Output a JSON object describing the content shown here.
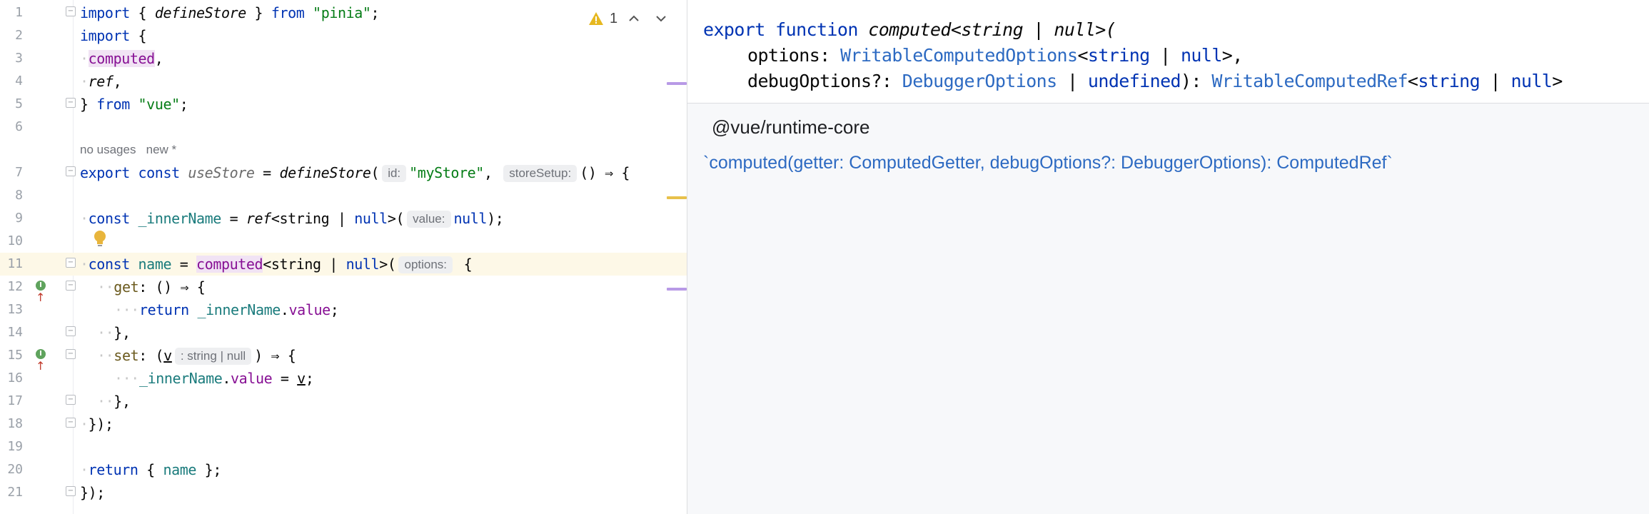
{
  "editor": {
    "line_numbers": [
      "1",
      "2",
      "3",
      "4",
      "5",
      "6",
      "7",
      "8",
      "9",
      "10",
      "11",
      "12",
      "13",
      "14",
      "15",
      "16",
      "17",
      "18",
      "19",
      "20",
      "21"
    ],
    "line1": {
      "kw_import": "import",
      "open": "{ ",
      "fn": "defineStore",
      "close": " } ",
      "kw_from": "from",
      "str": "\"pinia\"",
      "semi": ";"
    },
    "line2": {
      "kw_import": "import",
      "brace": " {"
    },
    "line3": {
      "name": "computed",
      "comma": ","
    },
    "line4": {
      "name": "ref",
      "comma": ","
    },
    "line5": {
      "brace": "} ",
      "kw_from": "from",
      "str": "\"vue\"",
      "semi": ";"
    },
    "usage_hint": "no usages   new *",
    "line7": {
      "kw_export": "export",
      "kw_const": "const",
      "var": "useStore",
      "eq": " = ",
      "fn": "defineStore",
      "paren": "(",
      "hint_id": "id:",
      "str": "\"myStore\"",
      "comma": ",",
      "hint_setup": "storeSetup:",
      "arrow": "() ⇒ {"
    },
    "line9": {
      "kw_const": "const",
      "var": "_innerName",
      "eq": " = ",
      "fn": "ref",
      "generic": "<string | ",
      "kw_null": "null",
      "gen_close": ">(",
      "hint_value": "value:",
      "kw_null2": "null",
      "end": ");"
    },
    "line11": {
      "kw_const": "const",
      "var": "name",
      "eq": " = ",
      "fn": "computed",
      "generic": "<string | ",
      "kw_null": "null",
      "gen_close": ">(",
      "hint_options": "options:",
      "brace": " {"
    },
    "line12": {
      "key": "get",
      "rest": ": () ⇒ {"
    },
    "line13": {
      "kw_return": "return",
      "var": "_innerName",
      "dot": ".",
      "prop": "value",
      "semi": ";"
    },
    "line14": {
      "text": "},"
    },
    "line15": {
      "key": "set",
      "rest1": ": (",
      "param": "v",
      "hint_type": ": string | null",
      "rest2": ") ⇒ {"
    },
    "line16": {
      "var": "_innerName",
      "dot": ".",
      "prop": "value",
      "eq": " = ",
      "param": "v",
      "semi": ";"
    },
    "line17": {
      "text": "},"
    },
    "line18": {
      "text": "});"
    },
    "line20": {
      "kw_return": "return",
      "rest": " { ",
      "var": "name",
      "close": " };"
    },
    "line21": {
      "text": "});"
    },
    "warnings": {
      "count": "1",
      "icon": "warning-icon"
    },
    "colors": {
      "keyword": "#0033b3",
      "string": "#067d17",
      "current_line": "#fdf8e7",
      "scroll_purple": "#b89ae6",
      "scroll_yellow": "#e8c14a"
    }
  },
  "doc": {
    "sig_line1": {
      "kw_export": "export",
      "kw_function": "function",
      "fn": "computed",
      "generic": "<string | null>("
    },
    "sig_line2": {
      "label": "options: ",
      "type": "WritableComputedOptions",
      "generic_open": "<",
      "kw_string": "string",
      "pipe": " | ",
      "kw_null": "null",
      "generic_close": ">,"
    },
    "sig_line3": {
      "label": "debugOptions?: ",
      "type": "DebuggerOptions",
      "pipe": " | ",
      "kw_undefined": "undefined",
      "close": "): ",
      "ret_type": "WritableComputedRef",
      "generic_open": "<",
      "kw_string": "string",
      "pipe2": " | ",
      "kw_null": "null",
      "generic_close": ">"
    },
    "module": "@vue/runtime-core",
    "link": "`computed(getter: ComputedGetter, debugOptions?: DebuggerOptions): ComputedRef`"
  }
}
